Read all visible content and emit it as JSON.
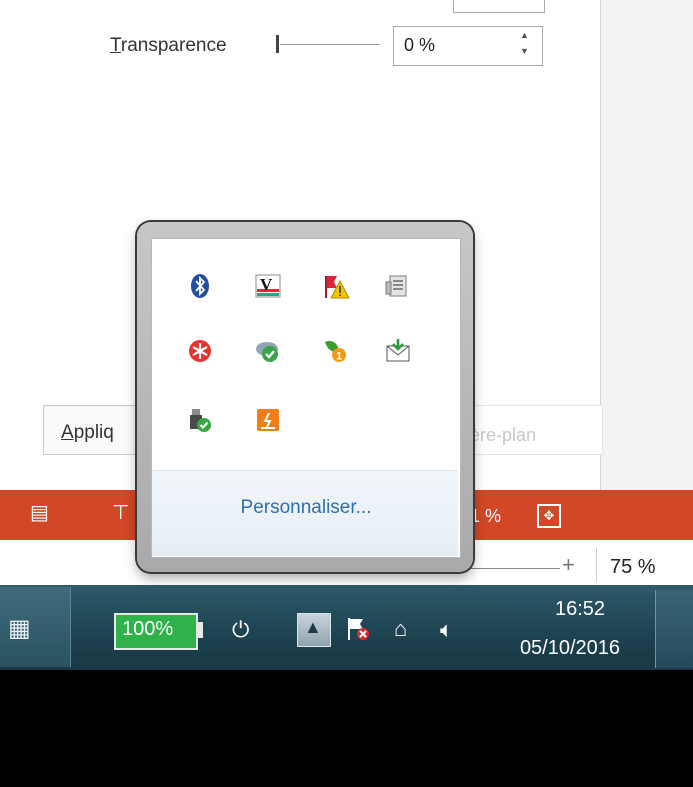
{
  "format_panel": {
    "transparency_label_first": "T",
    "transparency_label_rest": "ransparence",
    "transparency_value": "0 %",
    "transparency_slider": 0,
    "apply_button_first": "A",
    "apply_button_rest": "ppliq",
    "background_label": "ère-plan"
  },
  "status_bar": {
    "accent_color": "#d24726",
    "zoom_partial": "1 %"
  },
  "zoom": {
    "plus": "+",
    "value": "75 %"
  },
  "tray_popup": {
    "customize_label": "Personnaliser...",
    "icons": [
      "bluetooth-icon",
      "v-app-icon",
      "warning-flag-icon",
      "device-icon",
      "red-asterisk-icon",
      "cloud-check-icon",
      "badge-one-icon",
      "mail-icon",
      "usb-safe-icon",
      "orange-app-icon"
    ]
  },
  "taskbar": {
    "battery": "100%",
    "time": "16:52",
    "date": "05/10/2016",
    "show_hidden_symbol": "▲"
  }
}
